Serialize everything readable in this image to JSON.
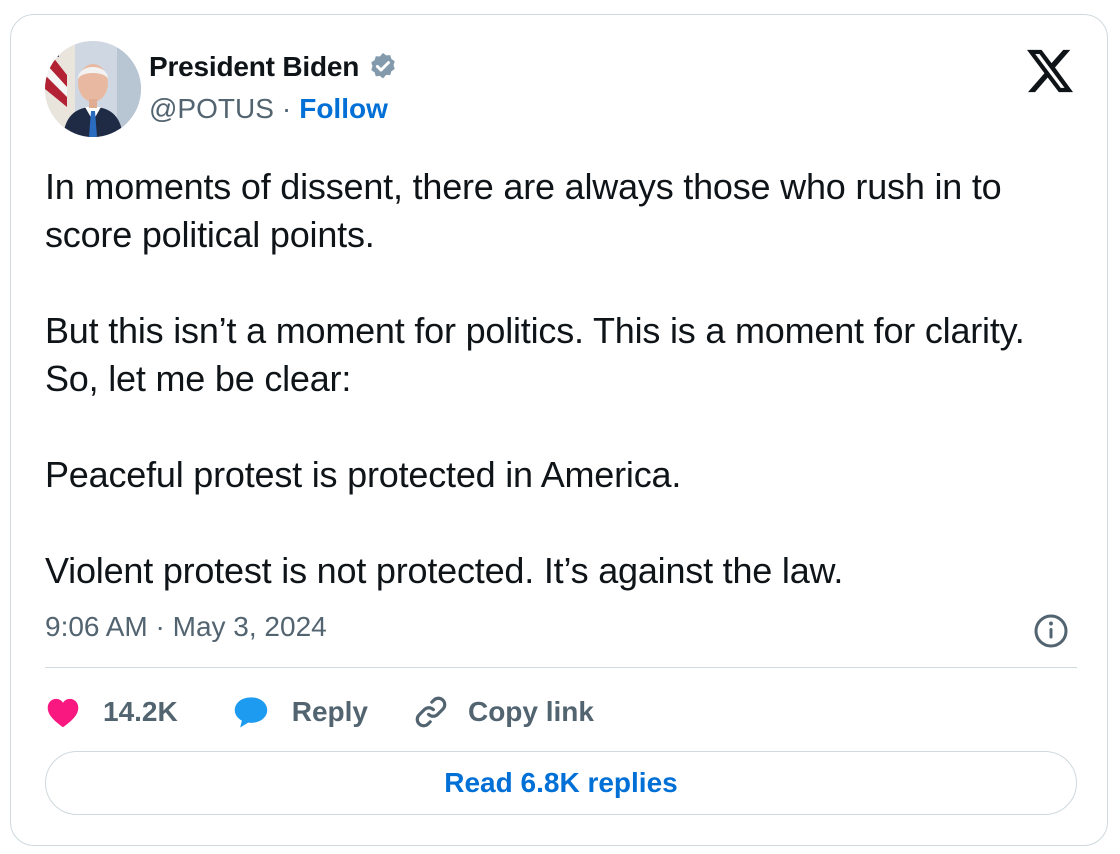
{
  "author": {
    "display_name": "President Biden",
    "handle": "@POTUS",
    "separator": "·",
    "follow_label": "Follow"
  },
  "tweet": {
    "paragraphs": [
      "In moments of dissent, there are always those who rush in to score political points.",
      "But this isn’t a moment for politics. This is a moment for clarity. So, let me be clear:",
      "Peaceful protest is protected in America.",
      "Violent protest is not protected. It’s against the law."
    ],
    "timestamp": "9:06 AM · May 3, 2024"
  },
  "actions": {
    "like_count": "14.2K",
    "reply_label": "Reply",
    "copy_link_label": "Copy link"
  },
  "footer": {
    "read_replies_label": "Read 6.8K replies"
  },
  "icons": {
    "verified": "verified-badge-icon",
    "brand": "x-logo-icon",
    "info": "info-icon",
    "like": "heart-icon",
    "reply": "speech-bubble-icon",
    "copy": "link-icon"
  },
  "colors": {
    "text": "#0f1419",
    "secondary": "#536471",
    "link": "#006fd6",
    "heart": "#f91880",
    "reply_bubble": "#1d9bf0",
    "border": "#cfd9de",
    "verified_badge": "#829aab"
  }
}
